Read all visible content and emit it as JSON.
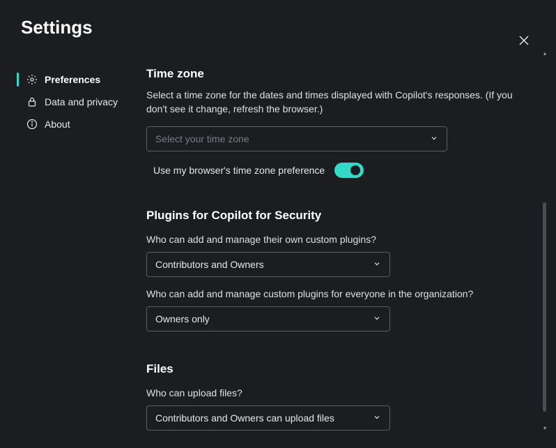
{
  "header": {
    "title": "Settings"
  },
  "sidebar": {
    "items": [
      {
        "label": "Preferences"
      },
      {
        "label": "Data and privacy"
      },
      {
        "label": "About"
      }
    ]
  },
  "timezone": {
    "heading": "Time zone",
    "description": "Select a time zone for the dates and times displayed with Copilot's responses. (If you don't see it change, refresh the browser.)",
    "placeholder": "Select your time zone",
    "toggleLabel": "Use my browser's time zone preference",
    "toggleOn": true
  },
  "plugins": {
    "heading": "Plugins for Copilot for Security",
    "q1": "Who can add and manage their own custom plugins?",
    "a1": "Contributors and Owners",
    "q2": "Who can add and manage custom plugins for everyone in the organization?",
    "a2": "Owners only"
  },
  "files": {
    "heading": "Files",
    "q1": "Who can upload files?",
    "a1": "Contributors and Owners can upload files"
  }
}
